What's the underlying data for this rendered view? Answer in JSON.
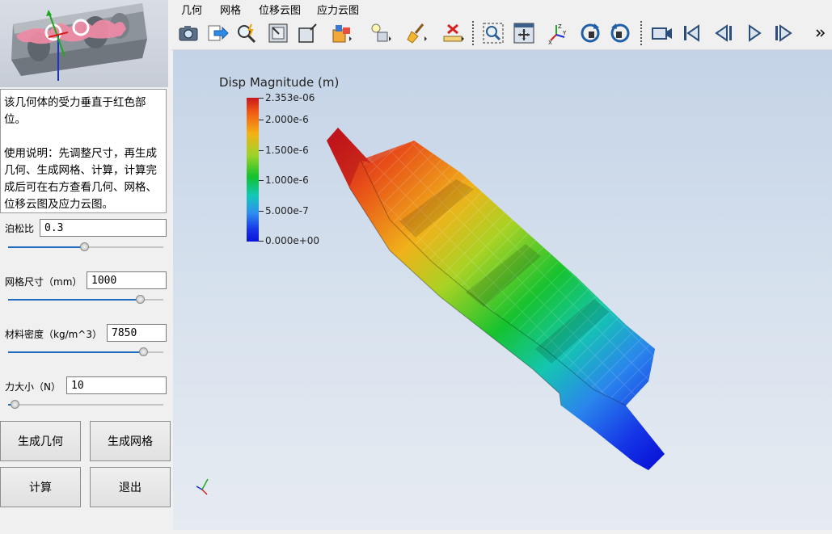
{
  "menu": {
    "items": [
      "几何",
      "网格",
      "位移云图",
      "应力云图"
    ]
  },
  "toolbar": {
    "buttons": [
      "camera-icon",
      "export-icon",
      "zoom-magic-icon",
      "reset-view-icon",
      "frame-icon",
      "color-cube-icon",
      "light-icon",
      "broom-icon",
      "ruler-x-icon",
      "zoom-select-icon",
      "fit-icon",
      "axes-icon",
      "rotate-cw-icon",
      "rotate-ccw-icon",
      "record-icon",
      "first-frame-icon",
      "prev-frame-icon",
      "play-icon",
      "last-frame-icon",
      "more-icon"
    ]
  },
  "description": {
    "line1": "该几何体的受力垂直于红色部位。",
    "line2": "使用说明：先调整尺寸，再生成几何、生成网格、计算，计算完成后可在右方查看几何、网格、位移云图及应力云图。"
  },
  "params": {
    "poisson": {
      "label": "泊松比",
      "value": "0.3",
      "level": 0.49
    },
    "mesh": {
      "label": "网格尺寸（mm）",
      "value": "1000",
      "level": 0.85
    },
    "density": {
      "label": "材料密度（kg/m^3）",
      "value": "7850",
      "level": 0.87
    },
    "force": {
      "label": "力大小（N）",
      "value": "10",
      "level": 0.04
    }
  },
  "buttons": {
    "gen_geometry": "生成几何",
    "gen_mesh": "生成网格",
    "compute": "计算",
    "exit": "退出"
  },
  "colorbar": {
    "title": "Disp Magnitude (m)",
    "labels": [
      "2.353e-06",
      "2.000e-6",
      "1.500e-6",
      "1.000e-6",
      "5.000e-7",
      "0.000e+00"
    ]
  },
  "colors": {
    "accent": "#1f6cbf",
    "max": "#c8161d",
    "min": "#0a14d8"
  }
}
